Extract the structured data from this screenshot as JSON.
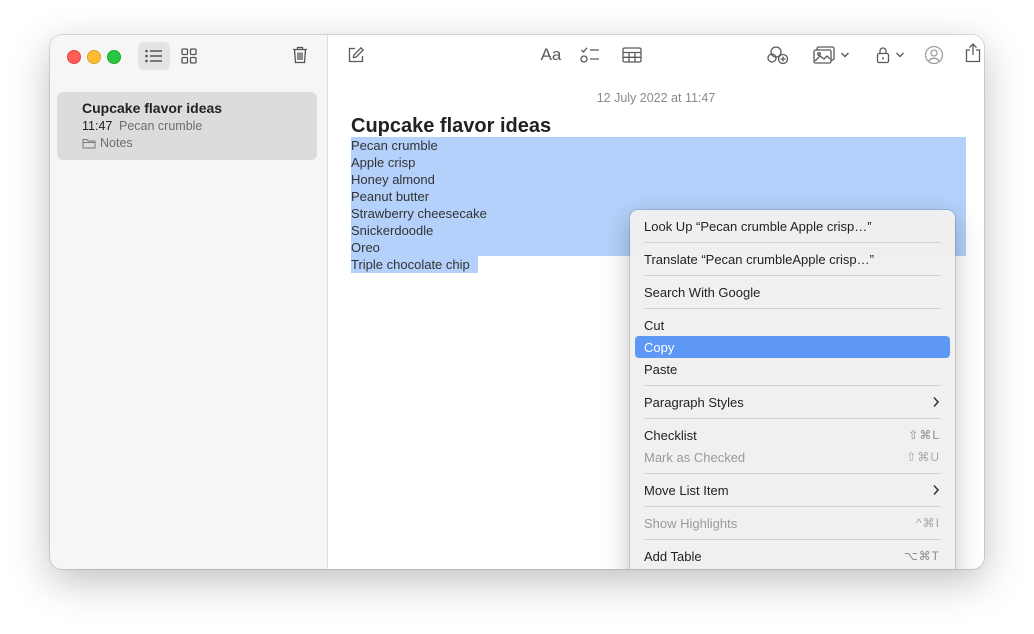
{
  "sidebar": {
    "note": {
      "title": "Cupcake flavor ideas",
      "time": "11:47",
      "preview": "Pecan crumble",
      "folder": "Notes"
    }
  },
  "editor": {
    "date": "12 July 2022 at 11:47",
    "title": "Cupcake flavor ideas",
    "lines": [
      "Pecan crumble",
      "Apple crisp",
      "Honey almond",
      "Peanut butter",
      "Strawberry cheesecake",
      "Snickerdoodle",
      "Oreo",
      "Triple chocolate chip"
    ],
    "format_label": "Aa"
  },
  "context_menu": {
    "look_up": "Look Up “Pecan crumble Apple crisp…”",
    "translate": "Translate “Pecan crumbleApple crisp…”",
    "search_google": "Search With Google",
    "cut": "Cut",
    "copy": "Copy",
    "paste": "Paste",
    "paragraph_styles": "Paragraph Styles",
    "checklist": "Checklist",
    "checklist_shortcut": "⇧⌘L",
    "mark_checked": "Mark as Checked",
    "mark_checked_shortcut": "⇧⌘U",
    "move_list_item": "Move List Item",
    "show_highlights": "Show Highlights",
    "show_highlights_shortcut": "^⌘I",
    "add_table": "Add Table",
    "add_table_shortcut": "⌥⌘T"
  },
  "colors": {
    "selection": "#b3d1fb",
    "menu_highlight": "#5e98f5",
    "close": "#ff5f57",
    "minimize": "#febc2e",
    "zoom": "#28c840"
  },
  "icons": {
    "sidebar_toolbar": [
      "list-view-icon",
      "gallery-view-icon",
      "trash-icon"
    ],
    "main_toolbar": [
      "compose-icon",
      "format-icon",
      "checklist-icon",
      "table-icon",
      "collaborate-icon",
      "media-icon",
      "lock-icon",
      "share-people-icon",
      "share-icon",
      "search-icon"
    ]
  }
}
